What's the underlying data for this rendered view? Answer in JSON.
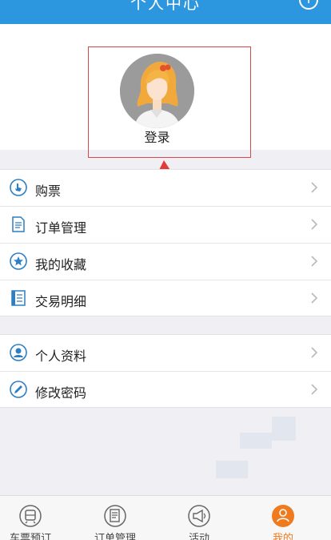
{
  "header": {
    "title": "个人中心"
  },
  "profile": {
    "login_label": "登录"
  },
  "menu_group_1": [
    {
      "label": "购票",
      "icon": "ticket-hand-icon"
    },
    {
      "label": "订单管理",
      "icon": "document-icon"
    },
    {
      "label": "我的收藏",
      "icon": "star-icon"
    },
    {
      "label": "交易明细",
      "icon": "ledger-icon"
    }
  ],
  "menu_group_2": [
    {
      "label": "个人资料",
      "icon": "user-icon"
    },
    {
      "label": "修改密码",
      "icon": "pencil-icon"
    }
  ],
  "tabbar": [
    {
      "label": "车票预订",
      "icon": "train-icon"
    },
    {
      "label": "订单管理",
      "icon": "order-icon"
    },
    {
      "label": "活动",
      "icon": "megaphone-icon"
    },
    {
      "label": "我的",
      "icon": "person-icon",
      "active": true
    }
  ],
  "colors": {
    "brand_blue": "#2c97de",
    "active_orange": "#f07b1e",
    "highlight_red": "#d9474a"
  }
}
